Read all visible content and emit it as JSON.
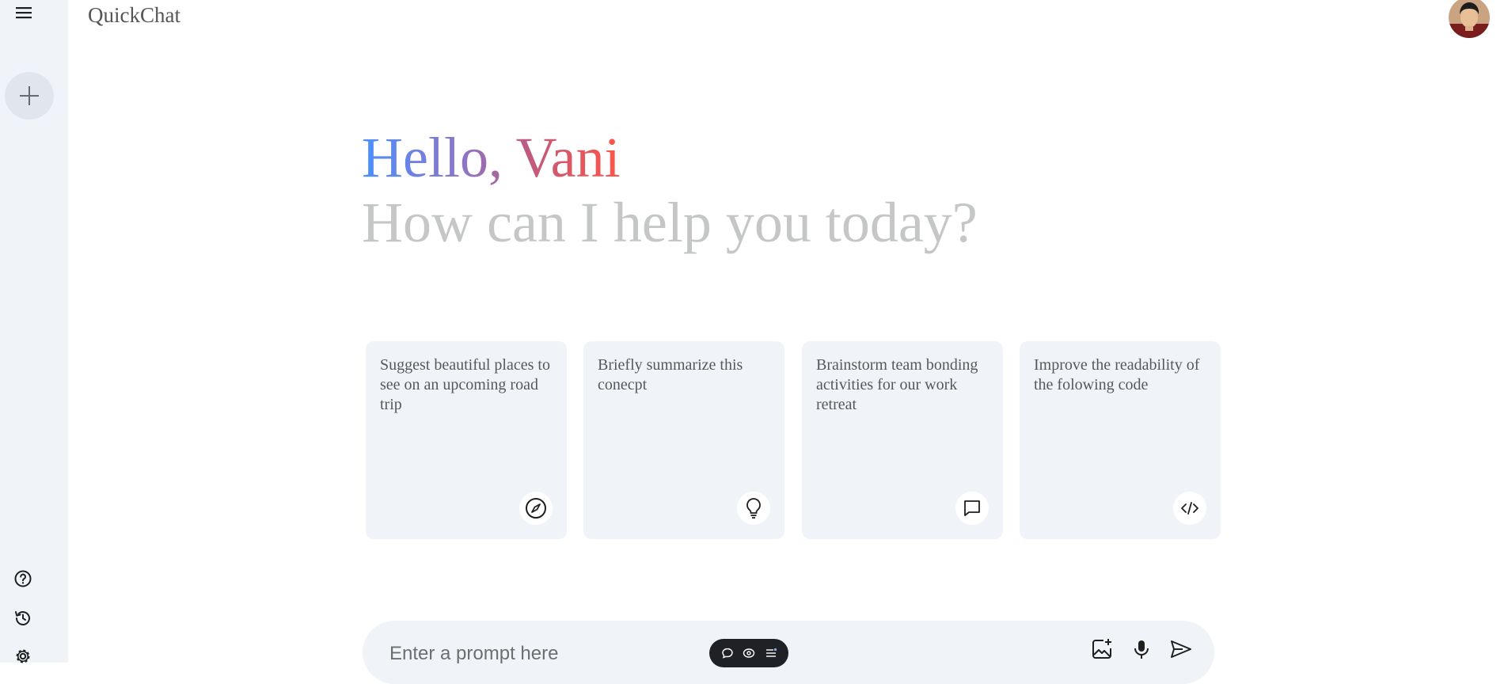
{
  "app": {
    "name": "QuickChat"
  },
  "greeting": {
    "hello": "Hello, Vani",
    "subtitle": "How can I help you today?"
  },
  "cards": [
    {
      "text": "Suggest beautiful places to see on an upcoming road trip",
      "icon": "compass-icon"
    },
    {
      "text": "Briefly summarize this conecpt",
      "icon": "lightbulb-icon"
    },
    {
      "text": "Brainstorm team bonding activities for our work retreat",
      "icon": "message-icon"
    },
    {
      "text": "Improve the readability of the folowing code",
      "icon": "code-icon"
    }
  ],
  "prompt": {
    "placeholder": "Enter a prompt here"
  },
  "sidebar": {
    "top_icons": [
      "menu-icon",
      "plus-icon"
    ],
    "bottom_icons": [
      "help-icon",
      "history-icon",
      "settings-icon"
    ]
  },
  "colors": {
    "sidebar_bg": "#f0f4f9",
    "card_bg": "#f0f4f9",
    "greeting_gradient": [
      "#4b90ff",
      "#ff5546"
    ],
    "subtitle": "#c4c7c5"
  }
}
